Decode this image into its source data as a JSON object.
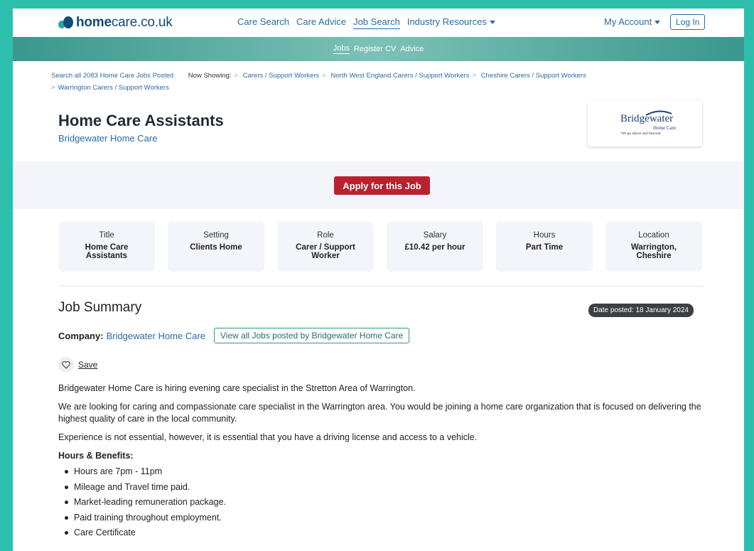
{
  "brand": {
    "logo_bold": "home",
    "logo_rest": "care.co.uk",
    "colors": {
      "accent": "#2cc0ac",
      "primary_link": "#2a6aa3",
      "apply": "#b8222e"
    }
  },
  "nav": {
    "items": [
      "Care Search",
      "Care Advice",
      "Job Search",
      "Industry Resources"
    ],
    "active": "Job Search",
    "account": "My Account",
    "login": "Log In"
  },
  "subnav": {
    "items": [
      "Jobs",
      "Register CV",
      "Advice"
    ],
    "active": "Jobs"
  },
  "breadcrumb": {
    "search_all": "Search all 2083 Home Care Jobs Posted",
    "now_showing": "Now Showing:",
    "items": [
      "Carers / Support Workers",
      "North West England Carers / Support Workers",
      "Cheshire Carers / Support Workers",
      "Warrington Carers / Support Workers"
    ]
  },
  "job": {
    "title": "Home Care Assistants",
    "company": "Bridgewater Home Care",
    "apply_label": "Apply for this Job",
    "logo": {
      "name": "Bridgewater",
      "sub": "Home Care",
      "tagline": "We go above and beyond"
    }
  },
  "details": [
    {
      "label": "Title",
      "value": "Home Care Assistants"
    },
    {
      "label": "Setting",
      "value": "Clients Home"
    },
    {
      "label": "Role",
      "value": "Carer / Support Worker"
    },
    {
      "label": "Salary",
      "value": "£10.42 per hour"
    },
    {
      "label": "Hours",
      "value": "Part Time"
    },
    {
      "label": "Location",
      "value": "Warrington, Cheshire"
    }
  ],
  "summary": {
    "heading": "Job Summary",
    "date_posted": "Date posted: 18 January 2024",
    "company_label": "Company:",
    "company_name": "Bridgewater Home Care",
    "view_all": "View all Jobs posted by Bridgewater Home Care",
    "save_label": "Save",
    "paragraphs": [
      "Bridgewater Home Care is hiring evening care specialist in the Stretton Area of Warrington.",
      "We are looking for caring and compassionate care specialist  in the Warrington area. You would be joining a home care organization that is focused on delivering the highest quality of care in the local community.",
      "Experience is not essential, however, it is essential that you have a driving license and access to a vehicle."
    ],
    "benefits_heading": "Hours & Benefits:",
    "benefits": [
      "Hours are 7pm - 11pm",
      "Mileage and Travel time paid.",
      "Market-leading remuneration package.",
      "Paid training throughout employment.",
      "Care Certificate"
    ]
  }
}
